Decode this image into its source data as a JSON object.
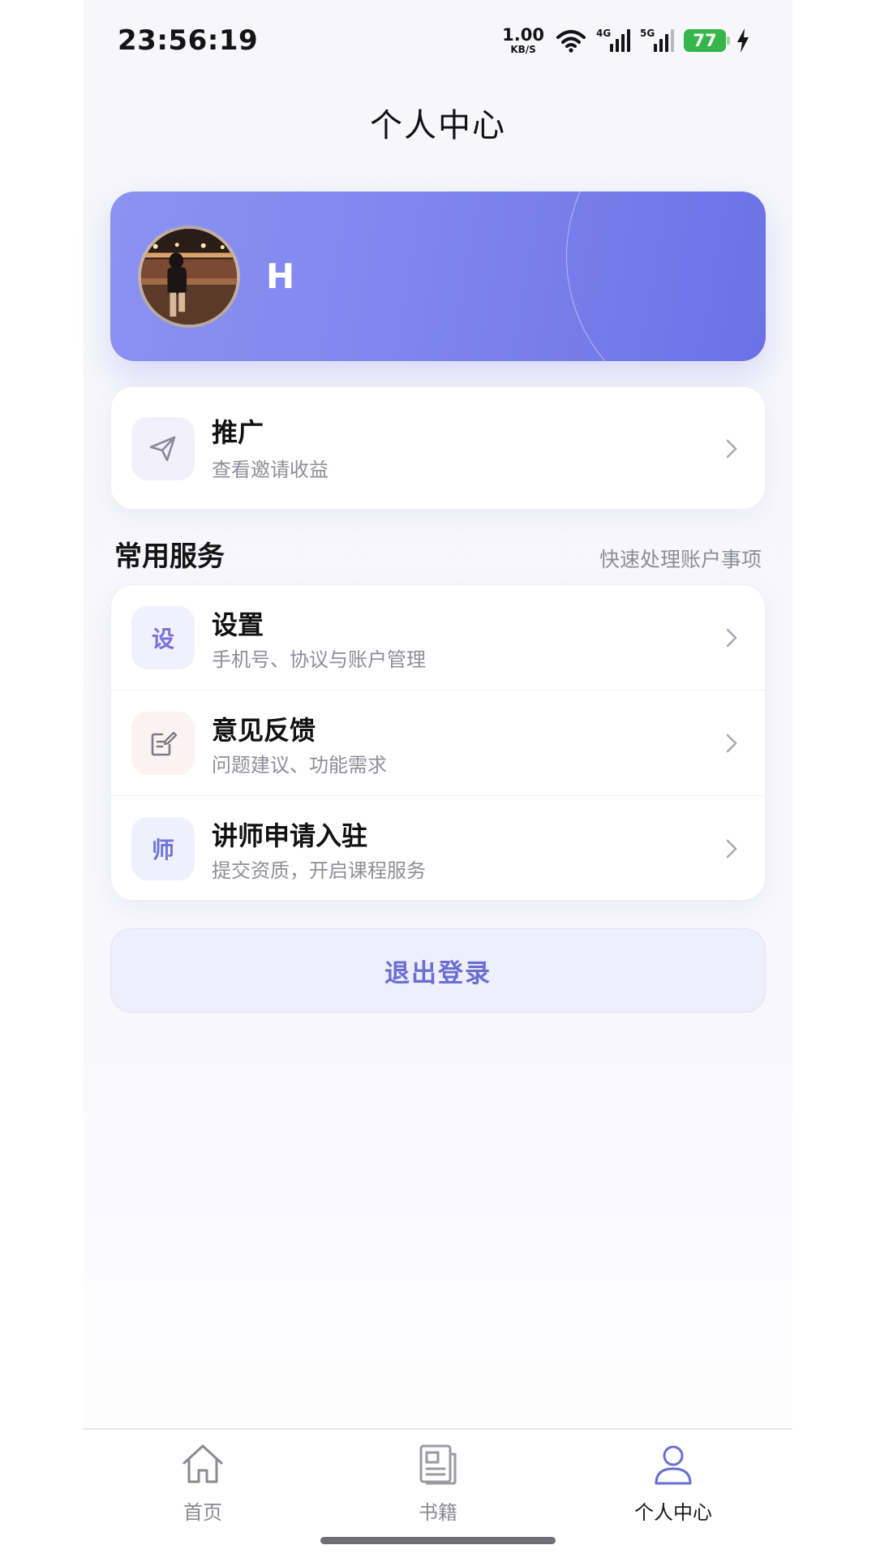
{
  "status_bar": {
    "time": "23:56:19",
    "net_speed_value": "1.00",
    "net_speed_unit": "KB/S",
    "signal_1_tag": "4G",
    "signal_2_tag": "5G",
    "battery_level": "77",
    "battery_color": "#35b54a"
  },
  "header": {
    "title": "个人中心"
  },
  "profile": {
    "name": "H",
    "card_color": "#7f86ee"
  },
  "promo": {
    "title": "推广",
    "subtitle": "查看邀请收益",
    "icon": "paper-plane-icon"
  },
  "services": {
    "title": "常用服务",
    "hint": "快速处理账户事项",
    "items": [
      {
        "title": "设置",
        "subtitle": "手机号、协议与账户管理",
        "icon_text": "设",
        "icon_color": "#7a72d6",
        "tile_color": "#f1f0fd"
      },
      {
        "title": "意见反馈",
        "subtitle": "问题建议、功能需求",
        "icon": "edit-note-icon",
        "tile_color": "#fdf2f2"
      },
      {
        "title": "讲师申请入驻",
        "subtitle": "提交资质，开启课程服务",
        "icon_text": "师",
        "icon_color": "#6f74d8",
        "tile_color": "#eff0fd"
      }
    ]
  },
  "logout": {
    "label": "退出登录",
    "text_color": "#6a6fd0"
  },
  "tab_bar": {
    "tabs": [
      {
        "label": "首页",
        "icon": "home-icon",
        "active": false
      },
      {
        "label": "书籍",
        "icon": "book-icon",
        "active": false
      },
      {
        "label": "个人中心",
        "icon": "user-icon",
        "active": true
      }
    ],
    "active_color": "#6a6fd0"
  }
}
